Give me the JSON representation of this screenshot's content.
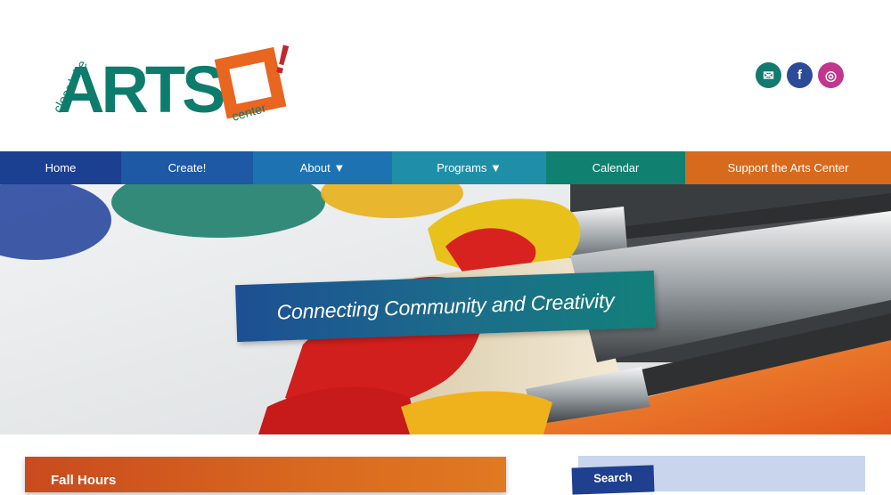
{
  "header": {
    "logo": {
      "line1": "clear lake",
      "word": "ARTS",
      "line2": "center",
      "exclaim": "!"
    },
    "social": [
      {
        "name": "email-icon",
        "glyph": "✉",
        "color": "#127a6e"
      },
      {
        "name": "facebook-icon",
        "glyph": "f",
        "color": "#2c4a97"
      },
      {
        "name": "instagram-icon",
        "glyph": "◎",
        "color": "#c2378e"
      }
    ]
  },
  "nav": {
    "items": [
      {
        "label": "Home",
        "color": "#1b3f91"
      },
      {
        "label": "Create!",
        "color": "#1d59a4"
      },
      {
        "label": "About ▼",
        "color": "#1d73b2"
      },
      {
        "label": "Programs ▼",
        "color": "#1f8fa8"
      },
      {
        "label": "Calendar",
        "color": "#108070"
      },
      {
        "label": "Support the Arts Center",
        "color": "#d76a1d"
      }
    ]
  },
  "hero": {
    "tagline": "Connecting Community and Creativity"
  },
  "main": {
    "section_title": "Fall Hours"
  },
  "sidebar": {
    "search_label": "Search"
  }
}
